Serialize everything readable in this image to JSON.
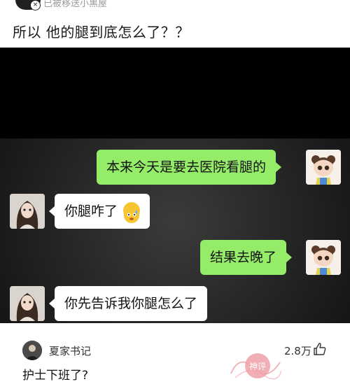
{
  "header": {
    "moved_text": "已被移送小黑屋",
    "post_title": "所以 他的腿到底怎么了？？"
  },
  "chat": {
    "messages": [
      {
        "side": "right",
        "text": "本来今天是要去医院看腿的"
      },
      {
        "side": "left",
        "text": "你腿咋了"
      },
      {
        "side": "right",
        "text": "结果去晚了"
      },
      {
        "side": "left",
        "text": "你先告诉我你腿怎么了"
      }
    ]
  },
  "comment": {
    "username": "夏家书记",
    "likes": "2.8万",
    "text": "护士下班了?",
    "stamp_text": "神评"
  },
  "colors": {
    "green_bubble": "#95ec69",
    "white_bubble": "#ffffff",
    "stamp": "#f0a0a8"
  }
}
